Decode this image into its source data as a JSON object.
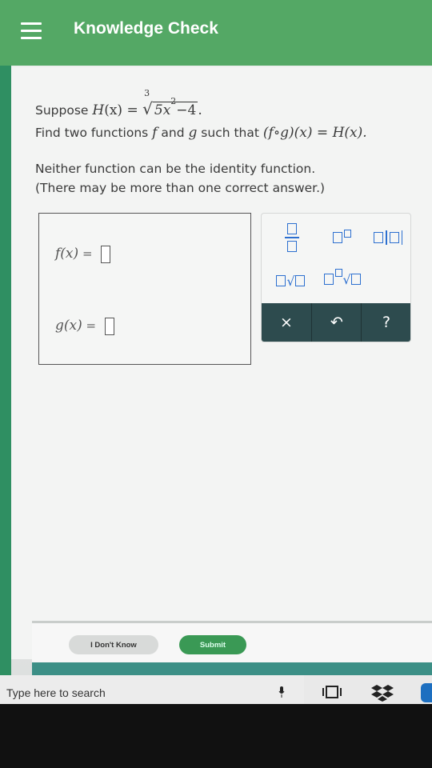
{
  "header": {
    "title": "Knowledge Check",
    "menu_icon": "hamburger-menu-icon"
  },
  "question": {
    "line1_prefix": "Suppose ",
    "H": "H",
    "x": "(x)",
    "eq": " = ",
    "root_index": "3",
    "radicand_base": "5x",
    "radicand_exp": "2",
    "radicand_rest": "−4",
    "period": ".",
    "line2_prefix": "Find two functions ",
    "f": "f",
    "and": " and ",
    "g": "g",
    "such_that": " such that ",
    "composition": "(f∘g)(x) = H(x).",
    "note1": "Neither function can be the identity function.",
    "note2": "(There may be more than one correct answer.)"
  },
  "answer": {
    "f_label": "f(x)",
    "g_label": "g(x)",
    "equals": "="
  },
  "keypad": {
    "clear_label": "×",
    "undo_label": "↶",
    "help_label": "?",
    "accent_color": "#2c6fd0",
    "dark_row_color": "#2d4b4e"
  },
  "footer": {
    "dont_know_label": "I Don't Know",
    "submit_label": "Submit"
  },
  "taskbar": {
    "search_placeholder": "Type here to search"
  }
}
